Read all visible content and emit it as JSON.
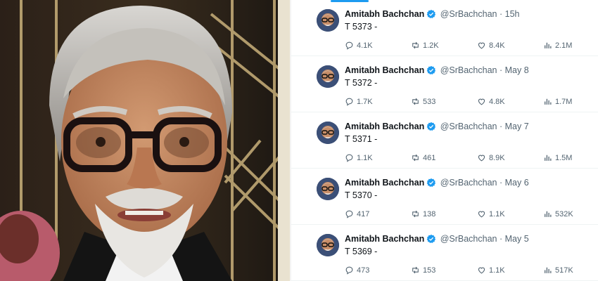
{
  "tweets": [
    {
      "name": "Amitabh Bachchan",
      "handle": "@SrBachchan",
      "sep": "·",
      "time": "15h",
      "text": "T 5373 -",
      "replies": "4.1K",
      "retweets": "1.2K",
      "likes": "8.4K",
      "views": "2.1M"
    },
    {
      "name": "Amitabh Bachchan",
      "handle": "@SrBachchan",
      "sep": "·",
      "time": "May 8",
      "text": "T 5372 -",
      "replies": "1.7K",
      "retweets": "533",
      "likes": "4.8K",
      "views": "1.7M"
    },
    {
      "name": "Amitabh Bachchan",
      "handle": "@SrBachchan",
      "sep": "·",
      "time": "May 7",
      "text": "T 5371 -",
      "replies": "1.1K",
      "retweets": "461",
      "likes": "8.9K",
      "views": "1.5M"
    },
    {
      "name": "Amitabh Bachchan",
      "handle": "@SrBachchan",
      "sep": "·",
      "time": "May 6",
      "text": "T 5370 -",
      "replies": "417",
      "retweets": "138",
      "likes": "1.1K",
      "views": "532K"
    },
    {
      "name": "Amitabh Bachchan",
      "handle": "@SrBachchan",
      "sep": "·",
      "time": "May 5",
      "text": "T 5369 -",
      "replies": "473",
      "retweets": "153",
      "likes": "1.1K",
      "views": "517K"
    }
  ],
  "icons": {
    "reply": "reply-icon",
    "retweet": "retweet-icon",
    "like": "heart-icon",
    "views": "views-chart-icon",
    "verified": "verified-badge-icon"
  },
  "colors": {
    "accent": "#1d9bf0",
    "text": "#0f1419",
    "muted": "#536471"
  }
}
